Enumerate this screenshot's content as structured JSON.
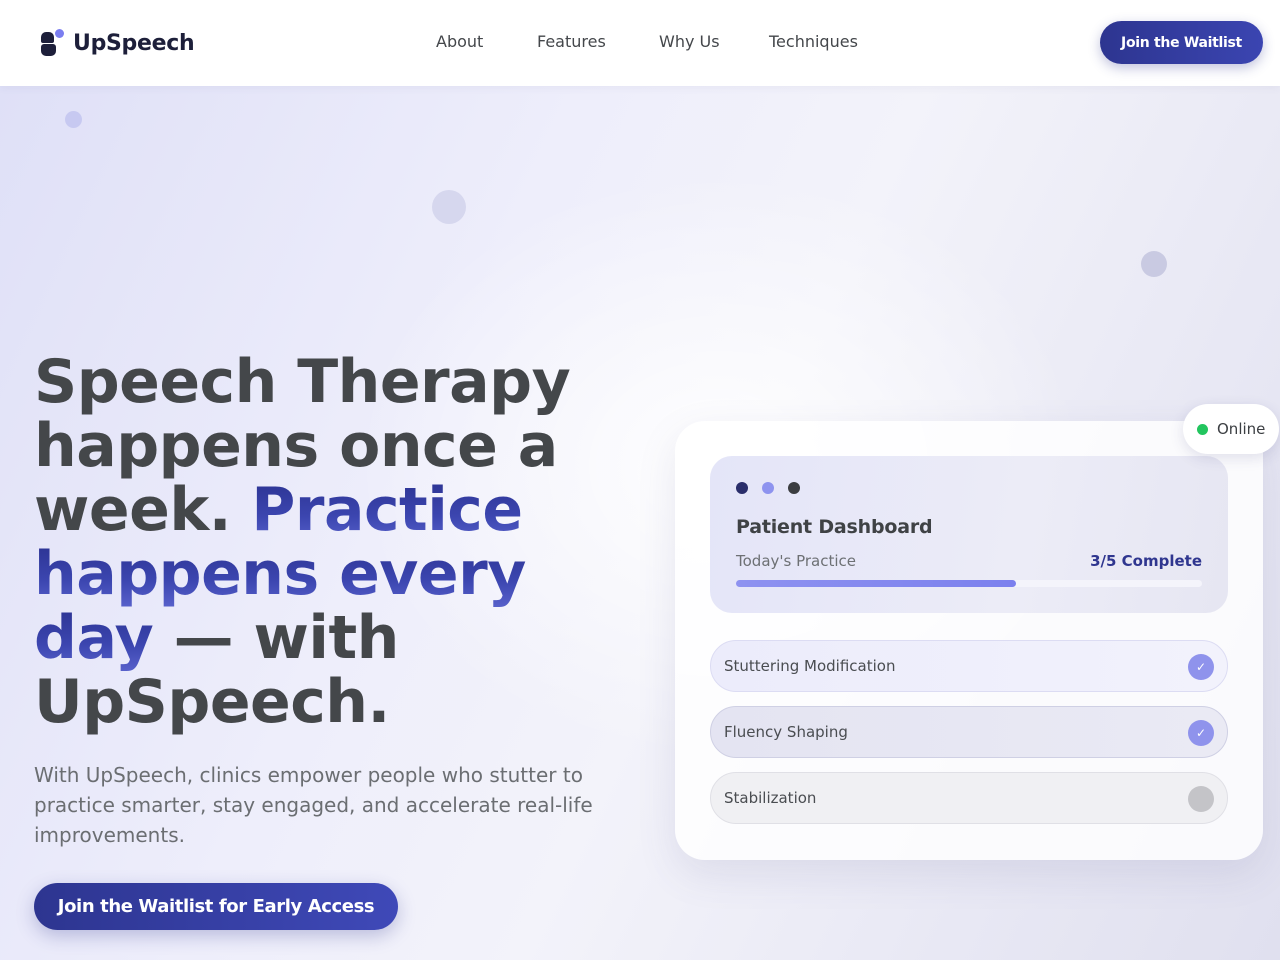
{
  "brand": {
    "name": "UpSpeech"
  },
  "nav": {
    "links": [
      {
        "label": "About"
      },
      {
        "label": "Features"
      },
      {
        "label": "Why Us"
      },
      {
        "label": "Techniques"
      }
    ],
    "cta_label": "Join the Waitlist"
  },
  "hero": {
    "headline_part1": "Speech Therapy happens once a week. ",
    "headline_accent": "Practice happens every day",
    "headline_part2": " — with UpSpeech.",
    "subtitle": "With UpSpeech, clinics empower people who stutter to practice smarter, stay engaged, and accelerate real-life improvements.",
    "cta_label": "Join the Waitlist for Early Access"
  },
  "card": {
    "status": "Online",
    "status_color": "#22c55e",
    "window_dots": [
      "#2a2e6b",
      "#8e93ef",
      "#3b3d41"
    ],
    "dashboard_title": "Patient Dashboard",
    "practice_label": "Today's Practice",
    "practice_status": "3/5 Complete",
    "progress_fraction": 0.6,
    "tasks": [
      {
        "label": "Stuttering Modification",
        "done": true,
        "mark": "✓"
      },
      {
        "label": "Fluency Shaping",
        "done": true,
        "mark": "✓"
      },
      {
        "label": "Stabilization",
        "done": false,
        "mark": ""
      }
    ]
  },
  "colors": {
    "brand_primary": "#2d3590",
    "accent_light": "#7b7ef0",
    "text_dark": "#44474a"
  }
}
